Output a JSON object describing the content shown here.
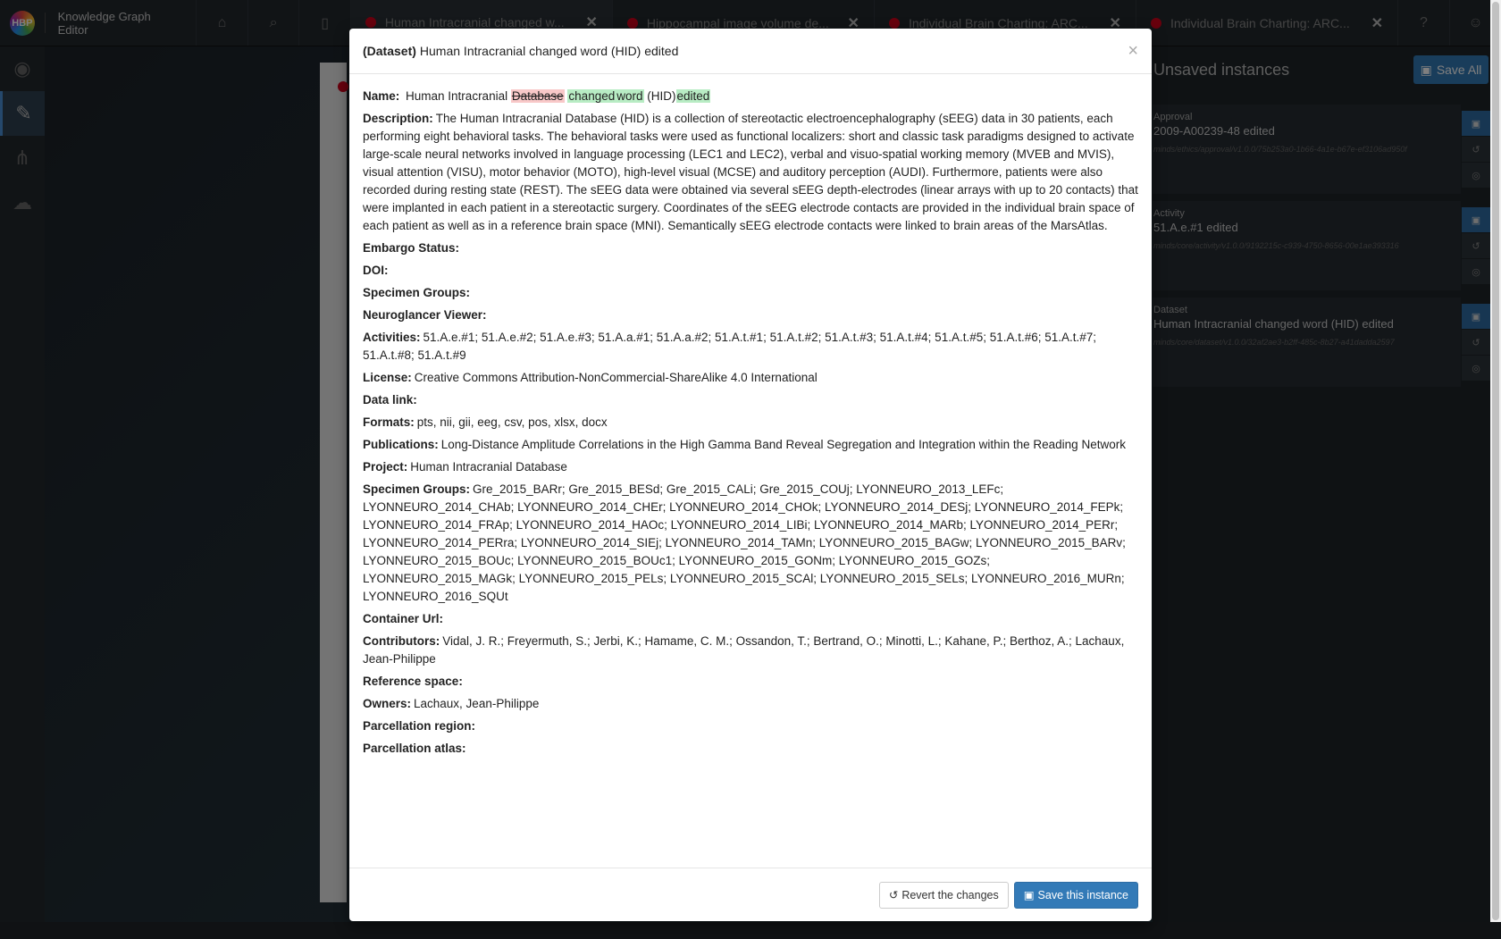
{
  "app": {
    "title": "Knowledge Graph Editor",
    "logo_text": "HBP"
  },
  "tabs": [
    {
      "label": "Human Intracranial changed w..."
    },
    {
      "label": "Hippocampal image volume de..."
    },
    {
      "label": "Individual Brain Charting: ARC..."
    },
    {
      "label": "Individual Brain Charting: ARC..."
    }
  ],
  "unsaved_panel": {
    "title": "Unsaved instances",
    "save_all_label": "Save All",
    "instances": [
      {
        "type": "Approval",
        "name": "2009-A00239-48 edited",
        "path": "minds/ethics/approval/v1.0.0/75b253a0-1b66-4a1e-b67e-ef3106ad950f"
      },
      {
        "type": "Activity",
        "name": "51.A.e.#1 edited",
        "path": "minds/core/activity/v1.0.0/9192215c-c939-4750-8656-00e1ae393316"
      },
      {
        "type": "Dataset",
        "name": "Human Intracranial changed word (HID) edited",
        "path": "minds/core/dataset/v1.0.0/32af2ae3-b2ff-485c-8b27-a41dadda2597"
      }
    ]
  },
  "modal": {
    "type_label": "(Dataset)",
    "title": "Human Intracranial changed word (HID) edited",
    "close": "×",
    "name_label": "Name:",
    "name_diff": {
      "plain1": "Human Intracranial",
      "removed": "Database",
      "added1": "changed",
      "added2": "word",
      "plain2": "(HID)",
      "added3": "edited"
    },
    "fields": [
      {
        "label": "Description:",
        "value": "The Human Intracranial Database (HID) is a collection of stereotactic electroencephalography (sEEG) data in 30 patients, each performing eight behavioral tasks. The behavioral tasks were used as functional localizers: short and classic task paradigms designed to activate large-scale neural networks involved in language processing (LEC1 and LEC2), verbal and visuo-spatial working memory (MVEB and MVIS), visual attention (VISU), motor behavior (MOTO), high-level visual (MCSE) and auditory perception (AUDI). Furthermore, patients were also recorded during resting state (REST). The sEEG data were obtained via several sEEG depth-electrodes (linear arrays with up to 20 contacts) that were implanted in each patient in a stereotactic surgery. Coordinates of the sEEG electrode contacts are provided in the individual brain space of each patient as well as in a reference brain space (MNI). Semantically sEEG electrode contacts were linked to brain areas of the MarsAtlas."
      },
      {
        "label": "Embargo Status:",
        "value": ""
      },
      {
        "label": "DOI:",
        "value": ""
      },
      {
        "label": "Specimen Groups:",
        "value": ""
      },
      {
        "label": "Neuroglancer Viewer:",
        "value": ""
      },
      {
        "label": "Activities:",
        "value": "51.A.e.#1; 51.A.e.#2; 51.A.e.#3; 51.A.a.#1; 51.A.a.#2; 51.A.t.#1; 51.A.t.#2; 51.A.t.#3; 51.A.t.#4; 51.A.t.#5; 51.A.t.#6; 51.A.t.#7; 51.A.t.#8; 51.A.t.#9"
      },
      {
        "label": "License:",
        "value": "Creative Commons Attribution-NonCommercial-ShareAlike 4.0 International"
      },
      {
        "label": "Data link:",
        "value": ""
      },
      {
        "label": "Formats:",
        "value": "pts, nii, gii, eeg, csv, pos, xlsx, docx"
      },
      {
        "label": "Publications:",
        "value": "Long-Distance Amplitude Correlations in the High Gamma Band Reveal Segregation and Integration within the Reading Network"
      },
      {
        "label": "Project:",
        "value": "Human Intracranial Database"
      },
      {
        "label": "Specimen Groups:",
        "value": "Gre_2015_BARr; Gre_2015_BESd; Gre_2015_CALi; Gre_2015_COUj; LYONNEURO_2013_LEFc; LYONNEURO_2014_CHAb; LYONNEURO_2014_CHEr; LYONNEURO_2014_CHOk; LYONNEURO_2014_DESj; LYONNEURO_2014_FEPk; LYONNEURO_2014_FRAp; LYONNEURO_2014_HAOc; LYONNEURO_2014_LIBi; LYONNEURO_2014_MARb; LYONNEURO_2014_PERr; LYONNEURO_2014_PERra; LYONNEURO_2014_SIEj; LYONNEURO_2014_TAMn; LYONNEURO_2015_BAGw; LYONNEURO_2015_BARv; LYONNEURO_2015_BOUc; LYONNEURO_2015_BOUc1; LYONNEURO_2015_GONm; LYONNEURO_2015_GOZs; LYONNEURO_2015_MAGk; LYONNEURO_2015_PELs; LYONNEURO_2015_SCAl; LYONNEURO_2015_SELs; LYONNEURO_2016_MURn; LYONNEURO_2016_SQUt"
      },
      {
        "label": "Container Url:",
        "value": ""
      },
      {
        "label": "Contributors:",
        "value": "Vidal, J. R.; Freyermuth, S.; Jerbi, K.; Hamame, C. M.; Ossandon, T.; Bertrand, O.; Minotti, L.; Kahane, P.; Berthoz, A.; Lachaux, Jean-Philippe"
      },
      {
        "label": "Reference space:",
        "value": ""
      },
      {
        "label": "Owners:",
        "value": "Lachaux, Jean-Philippe"
      },
      {
        "label": "Parcellation region:",
        "value": ""
      },
      {
        "label": "Parcellation atlas:",
        "value": ""
      }
    ],
    "revert_label": "Revert the changes",
    "save_label": "Save this instance"
  }
}
